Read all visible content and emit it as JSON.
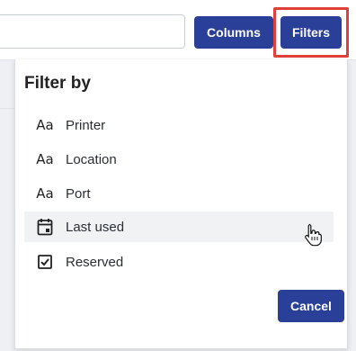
{
  "toolbar": {
    "search_placeholder": "",
    "columns_label": "Columns",
    "filters_label": "Filters"
  },
  "filter_panel": {
    "title": "Filter by",
    "items": [
      {
        "label": "Printer",
        "icon": "text-type-icon"
      },
      {
        "label": "Location",
        "icon": "text-type-icon"
      },
      {
        "label": "Port",
        "icon": "text-type-icon"
      },
      {
        "label": "Last used",
        "icon": "calendar-icon"
      },
      {
        "label": "Reserved",
        "icon": "checkbox-icon"
      }
    ],
    "cancel_label": "Cancel"
  },
  "colors": {
    "primary": "#2a3f98",
    "highlight": "#e0403a",
    "hover_row": "#f1f2f4"
  }
}
